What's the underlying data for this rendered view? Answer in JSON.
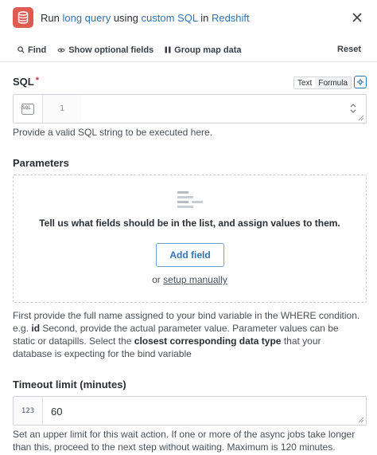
{
  "header": {
    "prefix": "Run",
    "action_link": "long query",
    "mid": "using",
    "method_link": "custom SQL",
    "in": "in",
    "app_link": "Redshift",
    "icon": "database-icon",
    "close_icon": "close-icon"
  },
  "toolbar": {
    "find": "Find",
    "show_optional": "Show optional fields",
    "group_map": "Group map data",
    "reset": "Reset"
  },
  "sql": {
    "label": "SQL",
    "required_mark": "*",
    "mode_text": "Text",
    "mode_formula": "Formula",
    "badge": "SQL",
    "line_number": "1",
    "value": "",
    "help": "Provide a valid SQL string to be executed here."
  },
  "parameters": {
    "label": "Parameters",
    "empty_message": "Tell us what fields should be in the list, and assign values to them.",
    "add_field": "Add field",
    "or": "or",
    "setup_manually": "setup manually",
    "help_part1": "First provide the full name assigned to your bind variable in the WHERE condition. e.g.",
    "help_example": "id",
    "help_part2": "Second, provide the actual parameter value. Parameter values can be static or datapills. Select the",
    "help_bold": "closest corresponding data type",
    "help_part3": "that your database is expecting for the bind variable"
  },
  "timeout": {
    "label": "Timeout limit (minutes)",
    "badge": "123",
    "value": "60",
    "help": "Set an upper limit for this wait action. If one or more of the async jobs take longer than this, proceed to the next step without waiting. Maximum is 120 minutes."
  },
  "colors": {
    "accent": "#2f74b6",
    "app_icon": "#e05a52",
    "required": "#d7302f"
  }
}
